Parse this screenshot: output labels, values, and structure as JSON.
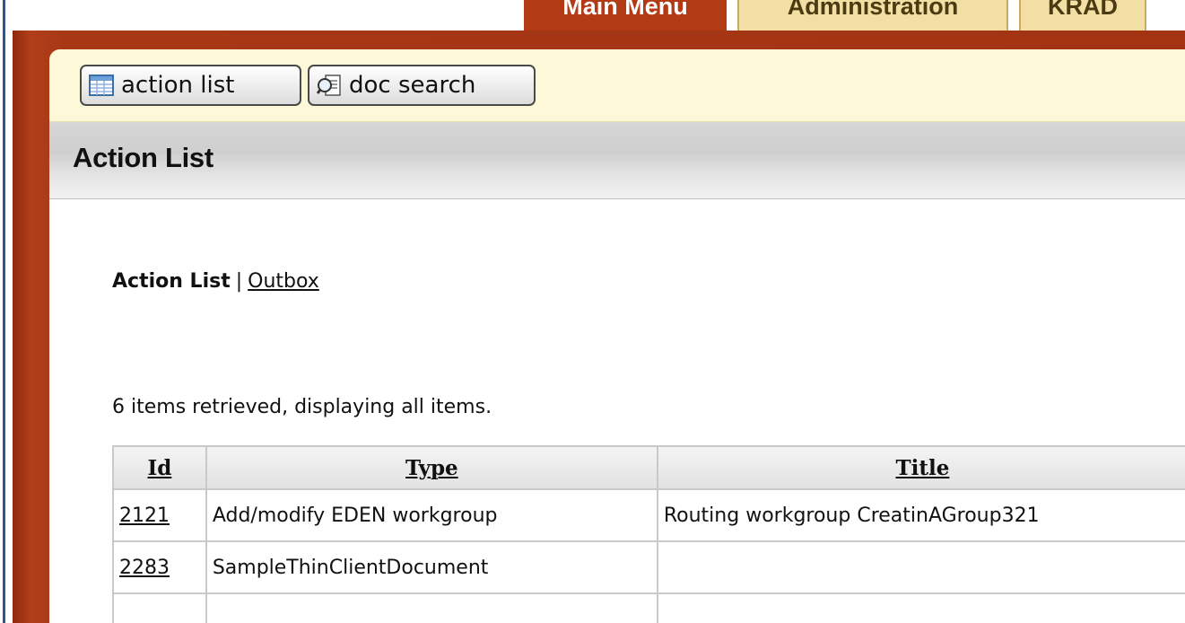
{
  "top_tabs": [
    {
      "label": "Main Menu"
    },
    {
      "label": "Administration"
    },
    {
      "label": "KRAD"
    }
  ],
  "toolbar": {
    "action_list_label": "action list",
    "doc_search_label": "doc search"
  },
  "page": {
    "title": "Action List"
  },
  "nav": {
    "current": "Action List",
    "separator": "|",
    "outbox": "Outbox"
  },
  "summary": "6 items retrieved, displaying all items.",
  "table": {
    "columns": [
      "Id",
      "Type",
      "Title"
    ],
    "rows": [
      {
        "id": "2121",
        "type": "Add/modify EDEN workgroup",
        "title": "Routing workgroup CreatinAGroup321"
      },
      {
        "id": "2283",
        "type": "SampleThinClientDocument",
        "title": ""
      },
      {
        "id": "",
        "type": "",
        "title": ""
      }
    ]
  },
  "colors": {
    "frame": "#a23414",
    "toolbar": "#fcf8d8",
    "active_tab": "#b23a14",
    "inactive_tab": "#f3dfa3"
  },
  "icons": {
    "action_list": "table-grid-icon",
    "doc_search": "magnifier-document-icon"
  }
}
